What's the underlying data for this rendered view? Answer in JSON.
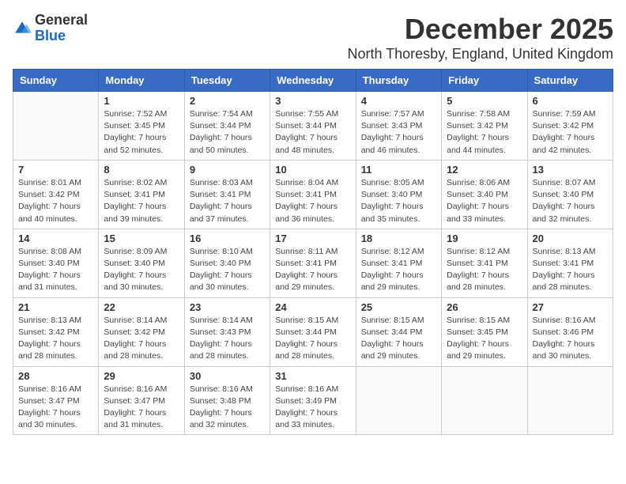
{
  "header": {
    "logo_general": "General",
    "logo_blue": "Blue",
    "month_title": "December 2025",
    "location": "North Thoresby, England, United Kingdom"
  },
  "weekdays": [
    "Sunday",
    "Monday",
    "Tuesday",
    "Wednesday",
    "Thursday",
    "Friday",
    "Saturday"
  ],
  "weeks": [
    [
      {
        "day": "",
        "info": ""
      },
      {
        "day": "1",
        "info": "Sunrise: 7:52 AM\nSunset: 3:45 PM\nDaylight: 7 hours\nand 52 minutes."
      },
      {
        "day": "2",
        "info": "Sunrise: 7:54 AM\nSunset: 3:44 PM\nDaylight: 7 hours\nand 50 minutes."
      },
      {
        "day": "3",
        "info": "Sunrise: 7:55 AM\nSunset: 3:44 PM\nDaylight: 7 hours\nand 48 minutes."
      },
      {
        "day": "4",
        "info": "Sunrise: 7:57 AM\nSunset: 3:43 PM\nDaylight: 7 hours\nand 46 minutes."
      },
      {
        "day": "5",
        "info": "Sunrise: 7:58 AM\nSunset: 3:42 PM\nDaylight: 7 hours\nand 44 minutes."
      },
      {
        "day": "6",
        "info": "Sunrise: 7:59 AM\nSunset: 3:42 PM\nDaylight: 7 hours\nand 42 minutes."
      }
    ],
    [
      {
        "day": "7",
        "info": "Sunrise: 8:01 AM\nSunset: 3:42 PM\nDaylight: 7 hours\nand 40 minutes."
      },
      {
        "day": "8",
        "info": "Sunrise: 8:02 AM\nSunset: 3:41 PM\nDaylight: 7 hours\nand 39 minutes."
      },
      {
        "day": "9",
        "info": "Sunrise: 8:03 AM\nSunset: 3:41 PM\nDaylight: 7 hours\nand 37 minutes."
      },
      {
        "day": "10",
        "info": "Sunrise: 8:04 AM\nSunset: 3:41 PM\nDaylight: 7 hours\nand 36 minutes."
      },
      {
        "day": "11",
        "info": "Sunrise: 8:05 AM\nSunset: 3:40 PM\nDaylight: 7 hours\nand 35 minutes."
      },
      {
        "day": "12",
        "info": "Sunrise: 8:06 AM\nSunset: 3:40 PM\nDaylight: 7 hours\nand 33 minutes."
      },
      {
        "day": "13",
        "info": "Sunrise: 8:07 AM\nSunset: 3:40 PM\nDaylight: 7 hours\nand 32 minutes."
      }
    ],
    [
      {
        "day": "14",
        "info": "Sunrise: 8:08 AM\nSunset: 3:40 PM\nDaylight: 7 hours\nand 31 minutes."
      },
      {
        "day": "15",
        "info": "Sunrise: 8:09 AM\nSunset: 3:40 PM\nDaylight: 7 hours\nand 30 minutes."
      },
      {
        "day": "16",
        "info": "Sunrise: 8:10 AM\nSunset: 3:40 PM\nDaylight: 7 hours\nand 30 minutes."
      },
      {
        "day": "17",
        "info": "Sunrise: 8:11 AM\nSunset: 3:41 PM\nDaylight: 7 hours\nand 29 minutes."
      },
      {
        "day": "18",
        "info": "Sunrise: 8:12 AM\nSunset: 3:41 PM\nDaylight: 7 hours\nand 29 minutes."
      },
      {
        "day": "19",
        "info": "Sunrise: 8:12 AM\nSunset: 3:41 PM\nDaylight: 7 hours\nand 28 minutes."
      },
      {
        "day": "20",
        "info": "Sunrise: 8:13 AM\nSunset: 3:41 PM\nDaylight: 7 hours\nand 28 minutes."
      }
    ],
    [
      {
        "day": "21",
        "info": "Sunrise: 8:13 AM\nSunset: 3:42 PM\nDaylight: 7 hours\nand 28 minutes."
      },
      {
        "day": "22",
        "info": "Sunrise: 8:14 AM\nSunset: 3:42 PM\nDaylight: 7 hours\nand 28 minutes."
      },
      {
        "day": "23",
        "info": "Sunrise: 8:14 AM\nSunset: 3:43 PM\nDaylight: 7 hours\nand 28 minutes."
      },
      {
        "day": "24",
        "info": "Sunrise: 8:15 AM\nSunset: 3:44 PM\nDaylight: 7 hours\nand 28 minutes."
      },
      {
        "day": "25",
        "info": "Sunrise: 8:15 AM\nSunset: 3:44 PM\nDaylight: 7 hours\nand 29 minutes."
      },
      {
        "day": "26",
        "info": "Sunrise: 8:15 AM\nSunset: 3:45 PM\nDaylight: 7 hours\nand 29 minutes."
      },
      {
        "day": "27",
        "info": "Sunrise: 8:16 AM\nSunset: 3:46 PM\nDaylight: 7 hours\nand 30 minutes."
      }
    ],
    [
      {
        "day": "28",
        "info": "Sunrise: 8:16 AM\nSunset: 3:47 PM\nDaylight: 7 hours\nand 30 minutes."
      },
      {
        "day": "29",
        "info": "Sunrise: 8:16 AM\nSunset: 3:47 PM\nDaylight: 7 hours\nand 31 minutes."
      },
      {
        "day": "30",
        "info": "Sunrise: 8:16 AM\nSunset: 3:48 PM\nDaylight: 7 hours\nand 32 minutes."
      },
      {
        "day": "31",
        "info": "Sunrise: 8:16 AM\nSunset: 3:49 PM\nDaylight: 7 hours\nand 33 minutes."
      },
      {
        "day": "",
        "info": ""
      },
      {
        "day": "",
        "info": ""
      },
      {
        "day": "",
        "info": ""
      }
    ]
  ]
}
